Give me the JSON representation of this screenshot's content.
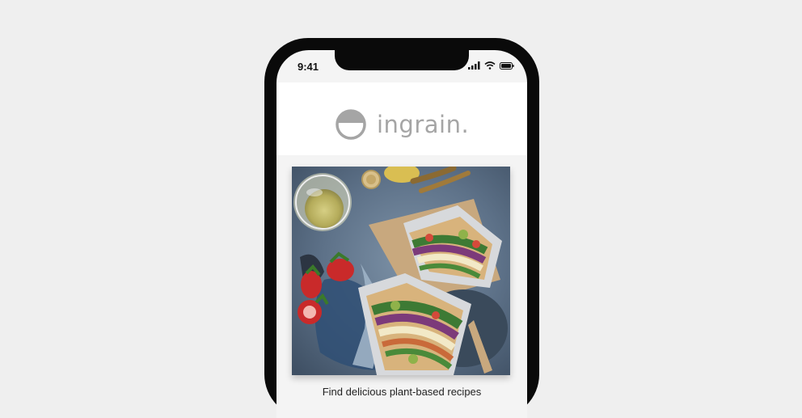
{
  "status_bar": {
    "time": "9:41"
  },
  "app": {
    "name": "ingrain."
  },
  "hero": {
    "image": "plant-based sandwich photo"
  },
  "tagline": "Find delicious plant-based recipes",
  "colors": {
    "background": "#efefef",
    "phone": "#0a0a0a",
    "screen": "#f4f4f4",
    "logo": "#a5a5a5"
  }
}
